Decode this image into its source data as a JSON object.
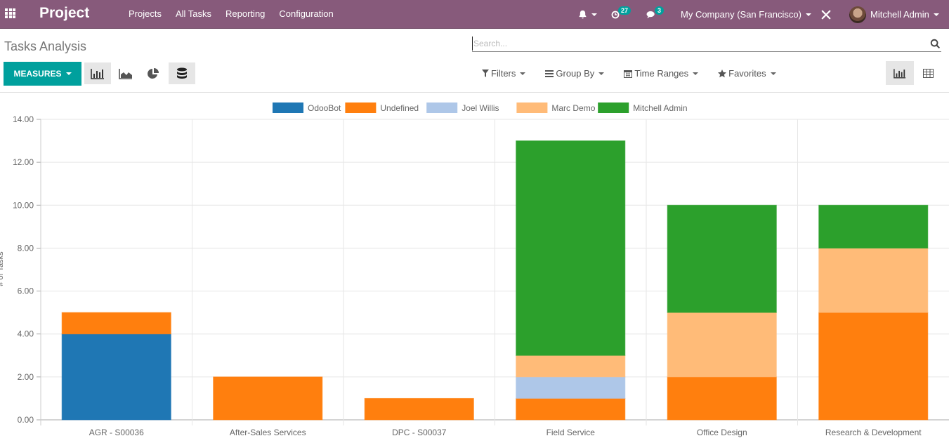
{
  "navbar": {
    "brand": "Project",
    "menu": [
      "Projects",
      "All Tasks",
      "Reporting",
      "Configuration"
    ],
    "activity_count": "27",
    "messages_count": "3",
    "company": "My Company (San Francisco)",
    "user": "Mitchell Admin"
  },
  "control_panel": {
    "title": "Tasks Analysis",
    "search_placeholder": "Search...",
    "measures_label": "MEASURES",
    "filters_label": "Filters",
    "group_by_label": "Group By",
    "time_ranges_label": "Time Ranges",
    "favorites_label": "Favorites",
    "chart_types": [
      "bar-chart",
      "line-chart",
      "pie-chart",
      "stacked"
    ],
    "views": [
      "graph-view",
      "pivot-view"
    ]
  },
  "colors": {
    "navbar": "#875a7b",
    "accent": "#00a09d"
  },
  "chart_data": {
    "type": "bar",
    "stacked": true,
    "title": "",
    "xlabel": "",
    "ylabel": "# of Tasks",
    "ylim": [
      0,
      14
    ],
    "yticks": [
      "0.00",
      "2.00",
      "4.00",
      "6.00",
      "8.00",
      "10.00",
      "12.00",
      "14.00"
    ],
    "grid": true,
    "legend_position": "top-center",
    "categories": [
      "AGR - S00036",
      "After-Sales Services",
      "DPC - S00037",
      "Field Service",
      "Office Design",
      "Research & Development"
    ],
    "series": [
      {
        "name": "OdooBot",
        "color": "#1f77b4",
        "values": [
          4,
          0,
          0,
          0,
          0,
          0
        ]
      },
      {
        "name": "Undefined",
        "color": "#ff7f0e",
        "values": [
          1,
          2,
          1,
          1,
          2,
          5
        ]
      },
      {
        "name": "Joel Willis",
        "color": "#aec7e8",
        "values": [
          0,
          0,
          0,
          1,
          0,
          0
        ]
      },
      {
        "name": "Marc Demo",
        "color": "#ffbb78",
        "values": [
          0,
          0,
          0,
          1,
          3,
          3
        ]
      },
      {
        "name": "Mitchell Admin",
        "color": "#2ca02c",
        "values": [
          0,
          0,
          0,
          10,
          5,
          2
        ]
      }
    ]
  }
}
